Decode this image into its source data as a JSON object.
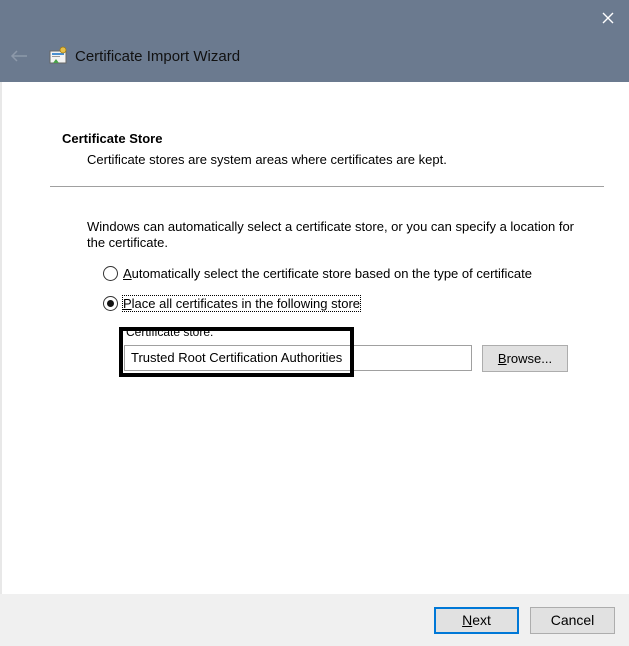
{
  "window": {
    "title": "Certificate Import Wizard"
  },
  "header": {
    "section_title": "Certificate Store",
    "section_subtitle": "Certificate stores are system areas where certificates are kept."
  },
  "main": {
    "description": "Windows can automatically select a certificate store, or you can specify a location for the certificate.",
    "radio_auto": {
      "prefix": "A",
      "rest": "utomatically select the certificate store based on the type of certificate",
      "checked": false
    },
    "radio_place": {
      "prefix": "P",
      "rest": "lace all certificates in the following store",
      "checked": true
    },
    "store_label": "Certificate store:",
    "store_value": "Trusted Root Certification Authorities",
    "browse_prefix": "B",
    "browse_rest": "rowse..."
  },
  "footer": {
    "next_prefix": "N",
    "next_rest": "ext",
    "cancel_label": "Cancel"
  },
  "colors": {
    "titlebar": "#6b7a8f",
    "next_border": "#0078d7"
  }
}
